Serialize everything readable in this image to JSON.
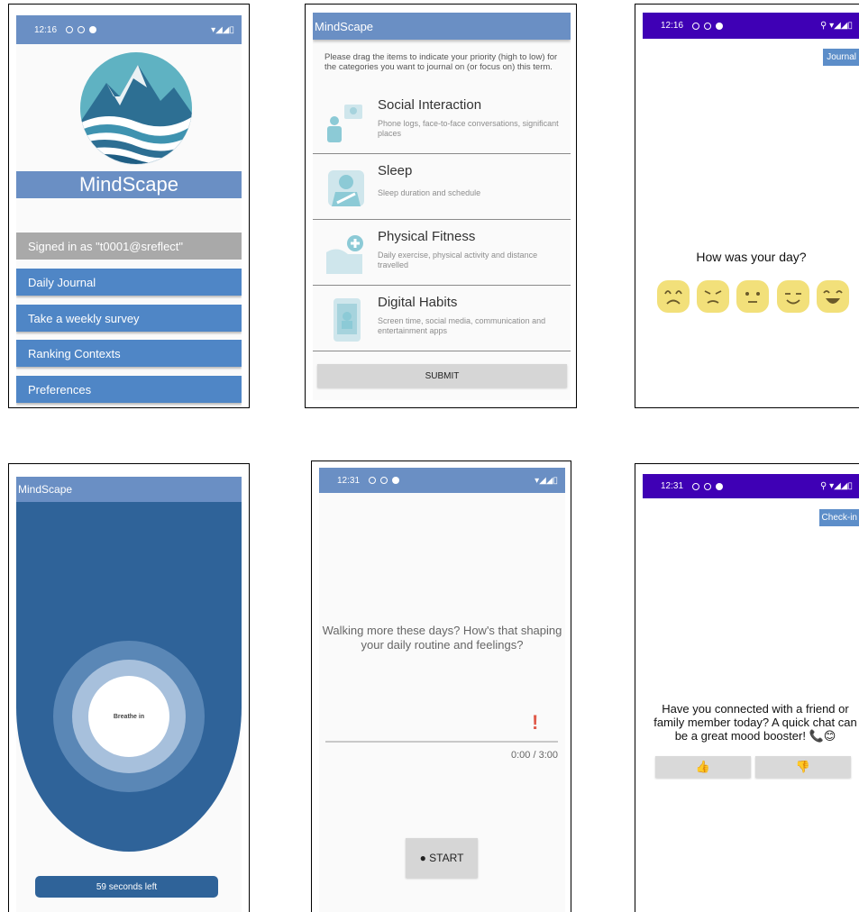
{
  "screen1": {
    "status": {
      "time": "12:16"
    },
    "app_title": "MindScape",
    "signed_in": "Signed in as \"t0001@sreflect\"",
    "menu": [
      "Daily Journal",
      "Take a weekly survey",
      "Ranking Contexts",
      "Preferences"
    ],
    "colors": {
      "primary": "#6a8fc4",
      "button": "#4f86c6",
      "signed_in_bg": "#a9a9a9"
    }
  },
  "screen2": {
    "app_title": "MindScape",
    "instructions": "Please drag the items to indicate your priority (high to low) for the categories you want to journal on (or focus on) this term.",
    "categories": [
      {
        "title": "Social Interaction",
        "desc": "Phone logs, face-to-face conversations, significant places",
        "icon": "social-icon"
      },
      {
        "title": "Sleep",
        "desc": "Sleep duration and schedule",
        "icon": "sleep-icon"
      },
      {
        "title": "Physical Fitness",
        "desc": "Daily exercise, physical activity and distance travelled",
        "icon": "fitness-icon"
      },
      {
        "title": "Digital Habits",
        "desc": "Screen time, social media, communication and entertainment apps",
        "icon": "phone-icon"
      }
    ],
    "submit": "SUBMIT"
  },
  "screen3": {
    "status": {
      "time": "12:16"
    },
    "journal_button": "Journal",
    "question": "How was your day?",
    "moods": [
      "very-sad-face-icon",
      "sad-face-icon",
      "neutral-face-icon",
      "happy-face-icon",
      "very-happy-face-icon"
    ],
    "colors": {
      "statusbar": "#3f00b5",
      "accent": "#5d8ec9",
      "emoji": "#f2e07a"
    }
  },
  "screen4": {
    "app_title": "MindScape",
    "breathe": "Breathe in",
    "timer": "59 seconds left",
    "colors": {
      "bg": "#2f6399",
      "ring": "#5a87b6",
      "inner": "#a7c0dc"
    }
  },
  "screen5": {
    "status": {
      "time": "12:31"
    },
    "prompt": "Walking more these days? How's that shaping your daily routine and feelings?",
    "alert": "!",
    "progress": "0:00 / 3:00",
    "start": "● START"
  },
  "screen6": {
    "status": {
      "time": "12:31"
    },
    "checkin_button": "Check-in",
    "message": "Have you connected with a friend or family member today? A quick chat can be a great mood booster! 📞😊",
    "thumbs_up": "👍",
    "thumbs_down": "👎"
  }
}
